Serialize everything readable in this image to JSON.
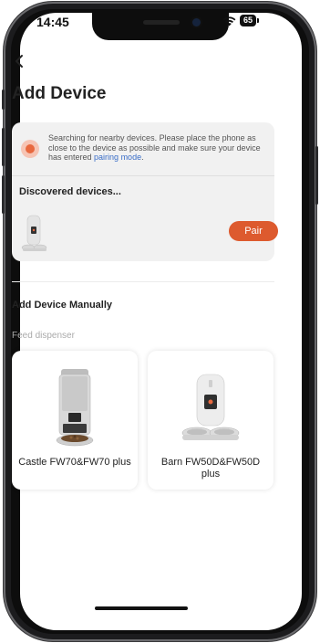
{
  "status_bar": {
    "time": "14:45",
    "battery": "65"
  },
  "header": {
    "title": "Add Device"
  },
  "search": {
    "message": "Searching for nearby devices. Please place the phone as close to the device as possible and make sure your device has entered ",
    "link_text": "pairing mode",
    "message_end": ".",
    "discovered_label": "Discovered devices...",
    "pair_label": "Pair"
  },
  "manual": {
    "title": "Add Device Manually",
    "category": "Feed dispenser",
    "products": [
      {
        "name": "Castle FW70&FW70 plus"
      },
      {
        "name": "Barn FW50D&FW50D plus"
      }
    ]
  },
  "colors": {
    "accent": "#dd5a2e",
    "link": "#3a6ec8",
    "card_bg": "#f1f1f1"
  }
}
